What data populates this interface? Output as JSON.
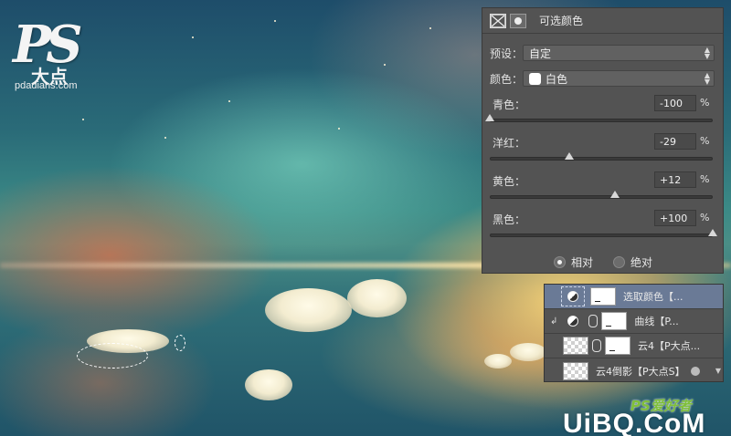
{
  "logo": {
    "mark": "PS",
    "sub": "大点",
    "url": "pdadians.com"
  },
  "panel": {
    "title": "可选颜色",
    "header_icons": [
      "adjustment-icon",
      "mask-icon"
    ],
    "preset": {
      "label": "预设：",
      "value": "自定"
    },
    "colors": {
      "label": "颜色：",
      "value": "白色",
      "swatch": "#ffffff"
    },
    "sliders": [
      {
        "label": "青色：",
        "value": "-100",
        "unit": "%",
        "level": -100
      },
      {
        "label": "洋红：",
        "value": "-29",
        "unit": "%",
        "level": -29
      },
      {
        "label": "黄色：",
        "value": "+12",
        "unit": "%",
        "level": 12
      },
      {
        "label": "黑色：",
        "value": "+100",
        "unit": "%",
        "level": 100
      }
    ],
    "method": {
      "relative": "相对",
      "absolute": "绝对",
      "selected": "relative"
    }
  },
  "layers": [
    {
      "name": "选取颜色【...",
      "type": "adjustment",
      "selected": true
    },
    {
      "name": "曲线【P...",
      "type": "adjustment-clipped",
      "selected": false
    },
    {
      "name": "云4【P大点...",
      "type": "image-mask",
      "selected": false
    },
    {
      "name": "云4倒影【P大点S】",
      "type": "image-fx",
      "selected": false
    }
  ],
  "watermark": {
    "line1": "PS爱好者",
    "line2": "UiBQ.CoM"
  },
  "colors": {
    "panel_bg": "#535353",
    "selected_layer": "#6a7a96"
  }
}
